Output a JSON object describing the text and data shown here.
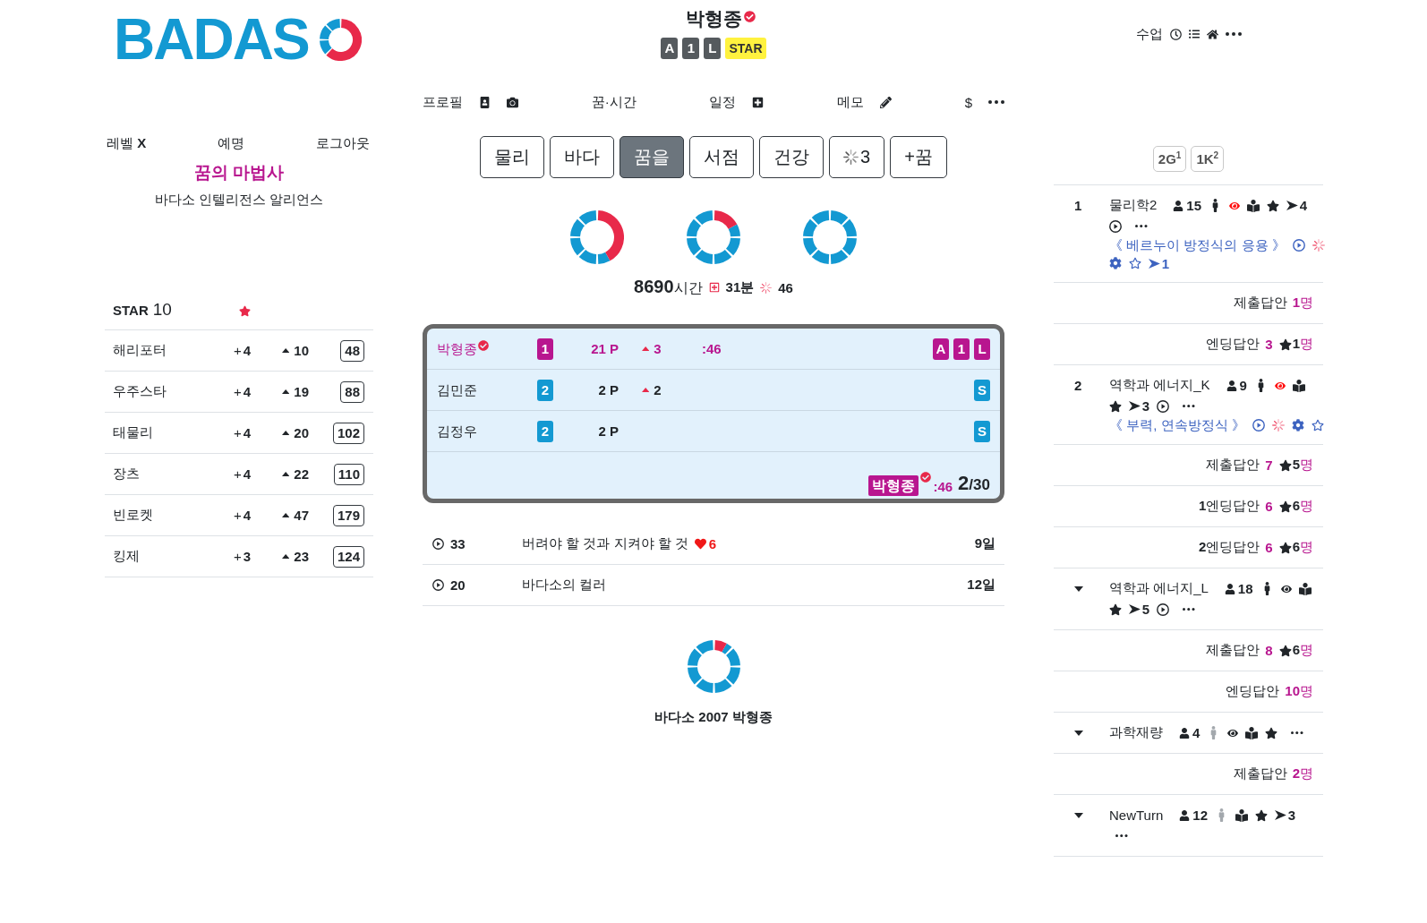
{
  "logo": {
    "text": "BADAS"
  },
  "account": {
    "links": [
      "레벨 **X**",
      "예명",
      "로그아웃"
    ],
    "title": "꿈의 마법사",
    "subtitle": "바다소 인텔리전스 알리언스"
  },
  "star_table": {
    "label": "STAR",
    "value": "10",
    "rows": [
      {
        "name": "해리포터",
        "plus": "+**4**",
        "up": "10",
        "total": "48"
      },
      {
        "name": "우주스타",
        "plus": "+**4**",
        "up": "19",
        "total": "88"
      },
      {
        "name": "태물리",
        "plus": "+**4**",
        "up": "20",
        "total": "102"
      },
      {
        "name": "장츠",
        "plus": "+**4**",
        "up": "22",
        "total": "110"
      },
      {
        "name": "빈로켓",
        "plus": "+**4**",
        "up": "47",
        "total": "179"
      },
      {
        "name": "킹제",
        "plus": "+**3**",
        "up": "23",
        "total": "124"
      }
    ]
  },
  "profile": {
    "name": "박형종",
    "verified": true,
    "badges": [
      {
        "kind": "grade",
        "text": "A"
      },
      {
        "kind": "grade",
        "text": "1"
      },
      {
        "kind": "grade",
        "text": "L"
      },
      {
        "kind": "highlight",
        "text": "STAR"
      }
    ]
  },
  "nav": [
    {
      "label": "프로필",
      "tools": [
        {
          "kind": "portrait"
        },
        {
          "kind": "camera"
        }
      ]
    },
    {
      "label": "꿈·시간"
    },
    {
      "label": "일정",
      "tools": [
        {
          "kind": "add"
        }
      ]
    },
    {
      "label": "메모",
      "tools": [
        {
          "kind": "edit"
        }
      ]
    },
    {
      "label": "$",
      "tools": [
        {
          "kind": "more"
        }
      ]
    }
  ],
  "tabs": [
    {
      "label": "물리",
      "selected": false,
      "loading": false
    },
    {
      "label": "바다",
      "selected": false,
      "loading": false
    },
    {
      "label": "꿈을",
      "selected": true,
      "loading": false
    },
    {
      "label": "서점",
      "selected": false,
      "loading": false
    },
    {
      "label": "건강",
      "selected": false,
      "loading": false
    },
    {
      "label": "3",
      "selected": false,
      "loading": true
    },
    {
      "label": "+꿈",
      "selected": false,
      "loading": false
    }
  ],
  "stats": {
    "hours": "8690",
    "hours_unit": "시간",
    "minutes": "31분",
    "count": "46"
  },
  "scoreboard": {
    "players": [
      {
        "name": "박형종",
        "verified": true,
        "current": true,
        "rank": "1",
        "points": "21 P",
        "up": "3",
        "time": ":46",
        "tags": [
          "A",
          "1",
          "L"
        ]
      },
      {
        "name": "김민준",
        "verified": false,
        "current": false,
        "rank": "2",
        "points": "2 P",
        "up": "2",
        "tags": [
          "S"
        ]
      },
      {
        "name": "김정우",
        "verified": false,
        "current": false,
        "rank": "2",
        "points": "2 P",
        "tags": [
          "S"
        ]
      }
    ],
    "footer": {
      "name": "박형종",
      "verified": true,
      "time": ":46",
      "done": "2",
      "total": "/30"
    }
  },
  "posts": [
    {
      "views": "33",
      "title": "버려야 할 것과 지켜야 할 것",
      "likes": "6",
      "age": "9일"
    },
    {
      "views": "20",
      "title": "바다소의 컬러",
      "age": "12일"
    }
  ],
  "summary": {
    "caption": "바다소 2007 박형종"
  },
  "classes": {
    "label": "수업",
    "tools": [
      {
        "kind": "clock"
      },
      {
        "kind": "list"
      },
      {
        "kind": "home"
      },
      {
        "kind": "more"
      }
    ],
    "chips": [
      "2G$^{1}$",
      "1K$^{2}$"
    ],
    "items": [
      {
        "number": "1",
        "title": "물리학2",
        "lines": [
          [
            {
              "kind": "members",
              "text": "15"
            },
            {
              "kind": "person",
              "on": true
            },
            {
              "kind": "watch",
              "on": true
            },
            {
              "kind": "book"
            },
            {
              "kind": "star"
            },
            {
              "kind": "next",
              "text": "4"
            }
          ],
          [
            {
              "kind": "play"
            },
            {
              "kind": "more"
            }
          ]
        ],
        "lesson": {
          "title": "《 베르누이 방정식의 응용 》",
          "lines": [
            [
              {
                "kind": "play"
              },
              {
                "kind": "loading"
              }
            ],
            [
              {
                "kind": "settings"
              },
              {
                "kind": "star_outline"
              },
              {
                "kind": "next",
                "text": "1"
              }
            ]
          ]
        },
        "answers": [
          {
            "label": "제출답안",
            "count": "1",
            "unit": "명"
          },
          {
            "label": "엔딩답안",
            "count": "3",
            "starred": "1",
            "unit": "명"
          }
        ]
      },
      {
        "number": "2",
        "title": "역학과 에너지_K",
        "lines": [
          [
            {
              "kind": "members",
              "text": "9"
            },
            {
              "kind": "person",
              "on": true
            },
            {
              "kind": "watch",
              "on": true
            },
            {
              "kind": "book"
            }
          ],
          [
            {
              "kind": "star"
            },
            {
              "kind": "next",
              "text": "3"
            },
            {
              "kind": "play"
            },
            {
              "kind": "more"
            }
          ]
        ],
        "lesson": {
          "title": "《 부력, 연속방정식 》",
          "lines": [
            [
              {
                "kind": "play"
              },
              {
                "kind": "loading"
              },
              {
                "kind": "settings"
              },
              {
                "kind": "star_outline"
              }
            ]
          ]
        },
        "answers": [
          {
            "label": "제출답안",
            "count": "7",
            "starred": "5",
            "unit": "명"
          },
          {
            "label": "**1**엔딩답안",
            "count": "6",
            "starred": "6",
            "unit": "명"
          },
          {
            "label": "**2**엔딩답안",
            "count": "6",
            "starred": "6",
            "unit": "명"
          }
        ]
      },
      {
        "title": "역학과 에너지_L",
        "lines": [
          [
            {
              "kind": "members",
              "text": "18"
            },
            {
              "kind": "person",
              "on": true
            },
            {
              "kind": "watch",
              "on": false
            },
            {
              "kind": "book"
            }
          ],
          [
            {
              "kind": "star"
            },
            {
              "kind": "next",
              "text": "5"
            },
            {
              "kind": "play"
            },
            {
              "kind": "more"
            }
          ]
        ],
        "answers": [
          {
            "label": "제출답안",
            "count": "8",
            "starred": "6",
            "unit": "명"
          },
          {
            "label": "엔딩답안",
            "count": "10",
            "unit": "명"
          }
        ]
      },
      {
        "title": "과학재량",
        "lines": [
          [
            {
              "kind": "members",
              "text": "4"
            },
            {
              "kind": "person",
              "on": false
            },
            {
              "kind": "watch",
              "on": false
            },
            {
              "kind": "book"
            },
            {
              "kind": "star"
            },
            {
              "kind": "more"
            }
          ]
        ],
        "answers": [
          {
            "label": "제출답안",
            "count": "2",
            "unit": "명"
          }
        ]
      },
      {
        "title": "NewTurn",
        "lines": [
          [
            {
              "kind": "members",
              "text": "12"
            },
            {
              "kind": "person",
              "on": false
            },
            {
              "kind": "book"
            },
            {
              "kind": "star"
            },
            {
              "kind": "next",
              "text": "3"
            }
          ],
          [
            {
              "kind": "more"
            }
          ]
        ]
      }
    ]
  }
}
